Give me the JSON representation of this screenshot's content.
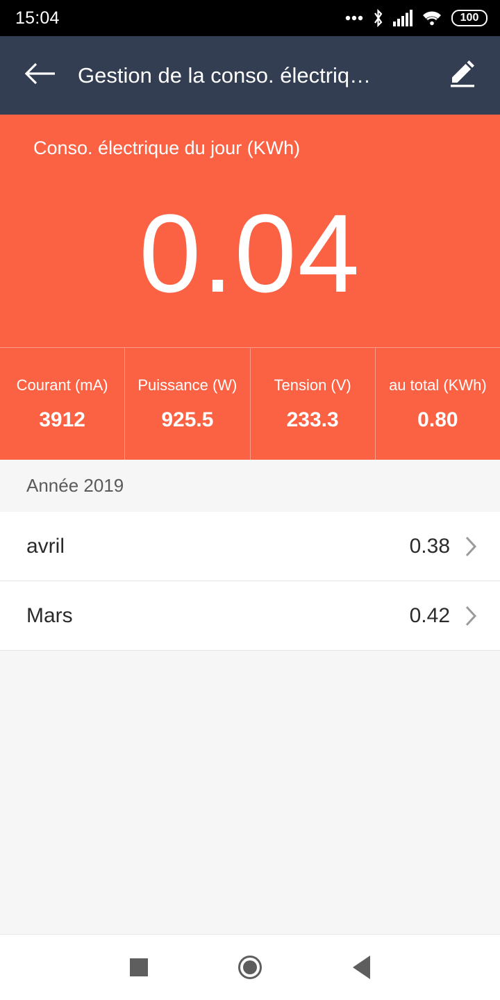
{
  "status_bar": {
    "clock": "15:04",
    "battery_level": "100",
    "icons": [
      "more-dots-icon",
      "bluetooth-icon",
      "cellular-signal-icon",
      "wifi-icon",
      "battery-icon"
    ]
  },
  "app_bar": {
    "title": "Gestion de la conso. électriq…",
    "back_icon": "arrow-left-icon",
    "edit_icon": "edit-pencil-icon",
    "background_color": "#333e52"
  },
  "hero": {
    "label": "Conso. électrique du jour (KWh)",
    "value": "0.04",
    "background_color": "#fb6143"
  },
  "stats": [
    {
      "label": "Courant (mA)",
      "value": "3912"
    },
    {
      "label": "Puissance (W)",
      "value": "925.5"
    },
    {
      "label": "Tension (V)",
      "value": "233.3"
    },
    {
      "label": "au total (KWh)",
      "value": "0.80"
    }
  ],
  "list": {
    "section_header": "Année 2019",
    "rows": [
      {
        "label": "avril",
        "value": "0.38",
        "chevron": "chevron-right-icon"
      },
      {
        "label": "Mars",
        "value": "0.42",
        "chevron": "chevron-right-icon"
      }
    ]
  },
  "nav_bar": {
    "recents_label": "recents",
    "home_label": "home",
    "back_label": "back"
  }
}
